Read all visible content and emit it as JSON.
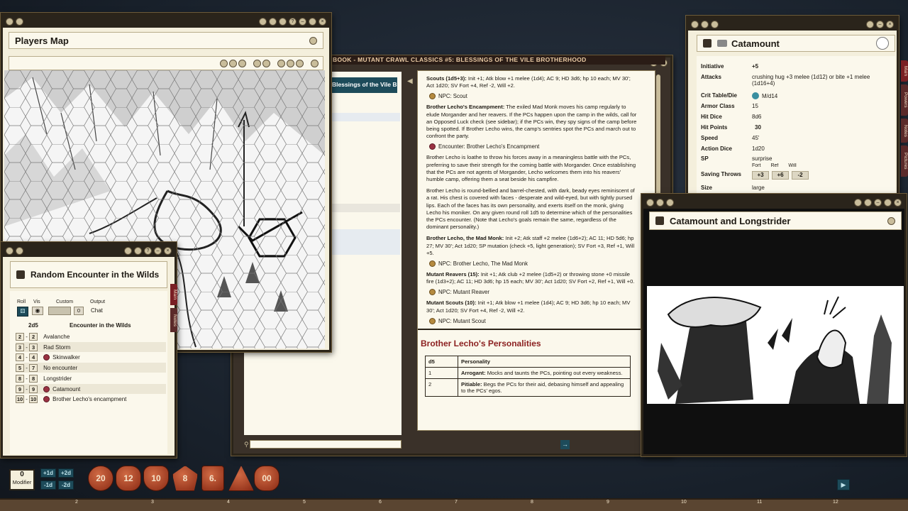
{
  "players_map": {
    "title": "Players Map"
  },
  "book": {
    "header": "BOOK - MUTANT CRAWL CLASSICS #5: BLESSINGS OF THE VILE BROTHERHOOD",
    "toc_item": "Blessings of the Vile B"
  },
  "page_content": {
    "scouts_b": "Scouts (1d5+3):",
    "scouts_t": " Init +1; Atk blow +1 melee (1d4); AC 9; HD 3d6; hp 10 each; MV 30'; Act 1d20; SV Fort +4, Ref -2, Will +2.",
    "npc_scout": "NPC: Scout",
    "enc_b": "Brother Lecho's Encampment:",
    "enc_t": " The exiled Mad Monk moves his camp regularly to elude Morgander and her reavers. If the PCs happen upon the camp in the wilds, call for an Opposed Luck check (see sidebar); if the PCs win, they spy signs of the camp before being spotted. If Brother Lecho wins, the camp's sentries spot the PCs and march out to confront the party.",
    "enc_link": "Encounter: Brother Lecho's Encampment",
    "p1": "Brother Lecho is loathe to throw his forces away in a meaningless battle with the PCs, preferring to save their strength for the coming battle with Morgander. Once establishing that the PCs are not agents of Morgander, Lecho welcomes them into his reavers' humble camp, offering them a seat beside his campfire.",
    "p2": "Brother Lecho is round-bellied and barrel-chested, with dark, beady eyes reminiscent of a rat. His chest is covered with faces - desperate and wild-eyed, but with tightly pursed lips. Each of the faces has its own personality, and exerts itself on the monk, giving Lecho his moniker. On any given round roll 1d5 to determine which of the personalities the PCs encounter. (Note that Lecho's goals remain the same, regardless of the dominant personality.)",
    "monk_b": "Brother Lecho, the Mad Monk:",
    "monk_t": " Init +2; Atk staff +2 melee (1d6+2); AC 11; HD 5d6; hp 27; MV 30'; Act 1d20; SP mutation (check +5, light generation); SV Fort +3, Ref +1, Will +5.",
    "npc_monk": "NPC: Brother Lecho, The Mad Monk",
    "reav_b": "Mutant Reavers (15):",
    "reav_t": " Init +1; Atk club +2 melee (1d5+2) or throwing stone +0 missile fire (1d3+2); AC 11; HD 3d6; hp 15 each; MV 30'; Act 1d20; SV Fort +2, Ref +1, Will +0.",
    "npc_reaver": "NPC: Mutant Reaver",
    "ms_b": "Mutant Scouts (10):",
    "ms_t": " Init +1; Atk blow +1 melee (1d4); AC 9; HD 3d6; hp 10 each; MV 30'; Act 1d20; SV Fort +4, Ref -2, Will +2.",
    "npc_mscout": "NPC: Mutant Scout",
    "section_title": "Brother Lecho's Personalities",
    "table_h1": "d5",
    "table_h2": "Personality",
    "rows": [
      {
        "n": "1",
        "b": "Arrogant:",
        "t": " Mocks and taunts the PCs, pointing out every weakness."
      },
      {
        "n": "2",
        "b": "Pitiable:",
        "t": " Begs the PCs for their aid, debasing himself and appealing to the PCs' egos."
      }
    ]
  },
  "catamount": {
    "title": "Catamount",
    "stats": [
      {
        "label": "Initiative",
        "value": "+5"
      },
      {
        "label": "Attacks",
        "value": "crushing hug +3 melee (1d12) or bite +1 melee (1d16+4)"
      },
      {
        "label": "Crit Table/Die",
        "value": "M/d14"
      },
      {
        "label": "Armor Class",
        "value": "15"
      },
      {
        "label": "Hit Dice",
        "value": "8d6"
      },
      {
        "label": "Hit Points",
        "value": "30"
      },
      {
        "label": "Speed",
        "value": "45'"
      },
      {
        "label": "Action Dice",
        "value": "1d20"
      },
      {
        "label": "SP",
        "value": "surprise"
      }
    ],
    "saves_label": "Saving Throws",
    "fort_label": "Fort",
    "ref_label": "Ref",
    "will_label": "Will",
    "fort": "+3",
    "ref": "+6",
    "will": "-2",
    "size_label": "Size",
    "size": "large",
    "tabs": [
      "Main",
      "Powers",
      "Notes",
      "Pictures"
    ]
  },
  "image_window": {
    "title": "Catamount and Longstrider"
  },
  "encounter": {
    "title": "Random Encounter in the Wilds",
    "col_roll": "Roll",
    "col_vis": "Vis",
    "col_custom": "Custom",
    "col_output": "Output",
    "custom_value": "0",
    "output_value": "Chat",
    "col_die": "2d5",
    "col_name": "Encounter in the Wilds",
    "rows": [
      {
        "a": "2",
        "b": "2",
        "name": "Avalanche",
        "link": false
      },
      {
        "a": "3",
        "b": "3",
        "name": "Rad Storm",
        "link": false
      },
      {
        "a": "4",
        "b": "4",
        "name": "Skinwalker",
        "link": true
      },
      {
        "a": "5",
        "b": "7",
        "name": "No encounter",
        "link": false
      },
      {
        "a": "8",
        "b": "8",
        "name": "Longstrider",
        "link": false
      },
      {
        "a": "9",
        "b": "9",
        "name": "Catamount",
        "link": true
      },
      {
        "a": "10",
        "b": "10",
        "name": "Brother Lecho's encampment",
        "link": true
      }
    ],
    "tabs": [
      "Main",
      "Notes"
    ]
  },
  "dice": {
    "modifier_value": "0",
    "modifier_label": "Modifier",
    "plus1": "+1d",
    "plus2": "+2d",
    "minus1": "-1d",
    "minus2": "-2d",
    "faces": [
      "20",
      "12",
      "10",
      "8",
      "6.",
      "",
      "00"
    ]
  },
  "ruler": [
    "2",
    "3",
    "4",
    "5",
    "6",
    "7",
    "8",
    "9",
    "10",
    "11",
    "12"
  ]
}
